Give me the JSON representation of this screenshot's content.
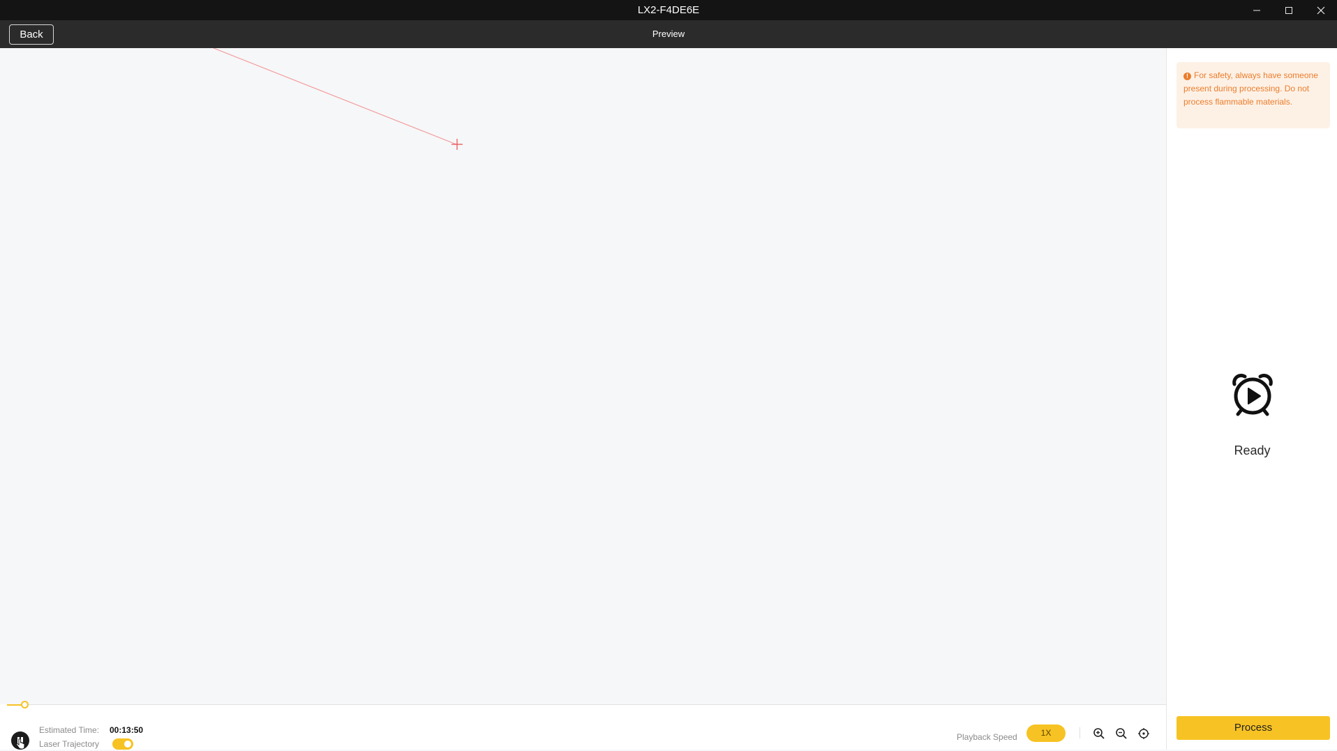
{
  "window": {
    "title": "LX2-F4DE6E",
    "controls": [
      "minimize-icon",
      "maximize-icon",
      "close-icon"
    ]
  },
  "toolbar": {
    "back_label": "Back",
    "title": "Preview"
  },
  "canvas": {
    "trajectory_color": "#f29b9b",
    "crosshair_color": "#e84b4b"
  },
  "bottom_bar": {
    "estimated_time_label": "Estimated Time:",
    "estimated_time_value": "00:13:50",
    "laser_trajectory_label": "Laser Trajectory",
    "laser_trajectory_enabled": true,
    "playback_progress_fraction": 0.015,
    "playback_speed_label": "Playback Speed",
    "playback_speed_value": "1X",
    "zoom_controls": [
      "zoom-in-icon",
      "zoom-out-icon",
      "fit-view-icon"
    ],
    "playback_state": "playing",
    "playback_button_icon": "pause-icon"
  },
  "panel": {
    "safety_notice": "For safety, always have someone present during processing. Do not process flammable materials.",
    "status_icon": "alarm-clock-play-icon",
    "status_text": "Ready",
    "process_label": "Process"
  },
  "colors": {
    "accent": "#f7c223",
    "warning": "#ec7c2a",
    "warning_bg": "#fdf1e6",
    "titlebar": "#141414",
    "toolbar": "#2b2b2b"
  }
}
